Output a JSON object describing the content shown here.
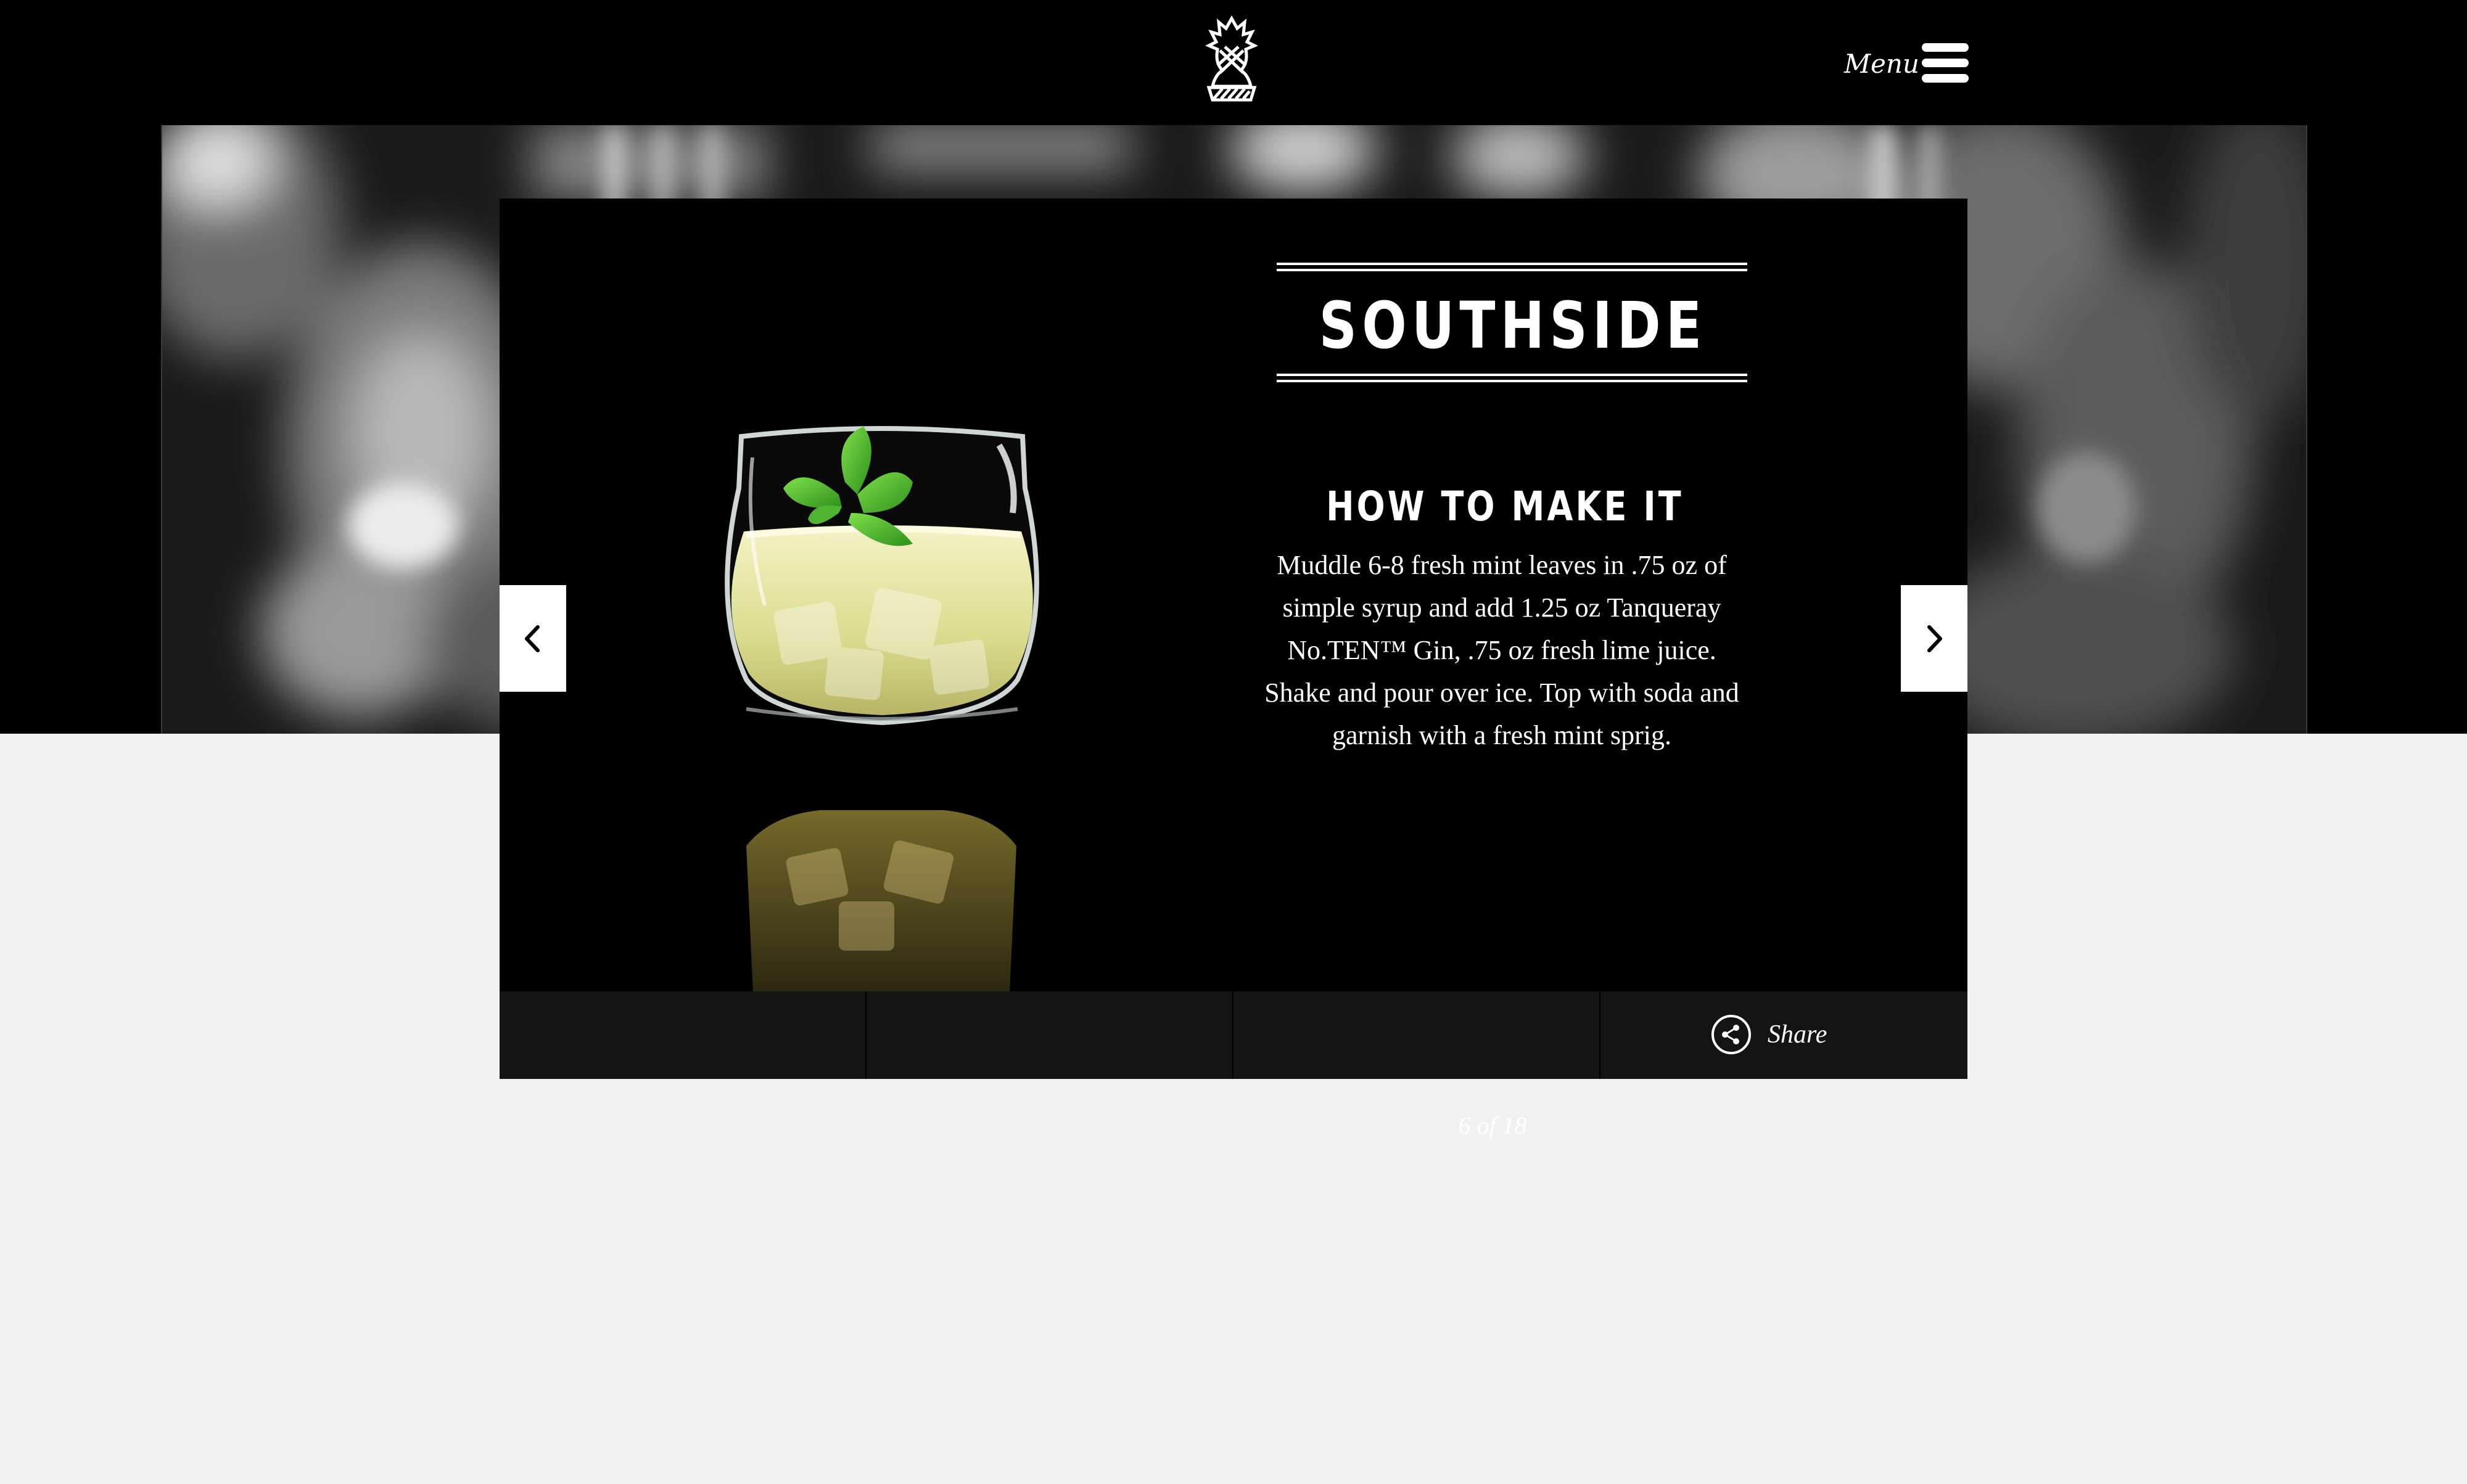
{
  "header": {
    "menu_label": "Menu",
    "logo_icon": "tanqueray-crest-icon",
    "menu_icon": "hamburger-menu-icon"
  },
  "recipe": {
    "title": "SOUTHSIDE",
    "section_heading": "HOW TO MAKE IT",
    "instructions": "Muddle 6-8 fresh mint leaves in .75 oz of simple syrup and add 1.25 oz Tanqueray No.TEN™ Gin, .75 oz fresh lime juice. Shake and pour over ice. Top with soda and garnish with a fresh mint sprig.",
    "counter": "6 of 18",
    "prev_icon": "chevron-left-icon",
    "next_icon": "chevron-right-icon"
  },
  "footer": {
    "share_label": "Share",
    "share_icon": "share-icon"
  },
  "colors": {
    "header_bg": "#000000",
    "card_bg": "#000000",
    "footer_bar_bg": "#141414",
    "page_bg": "#f1f1f1",
    "text": "#ffffff",
    "mint": "#5cc23a",
    "drink": "#e4e8a6"
  }
}
